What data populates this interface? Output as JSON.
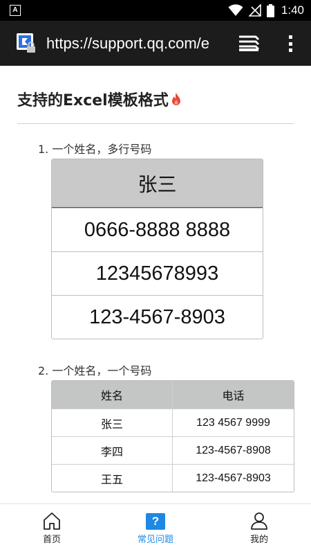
{
  "status_bar": {
    "app_badge": "A",
    "time": "1:40"
  },
  "browser": {
    "url": "https://support.qq.com/e"
  },
  "page": {
    "title": "支持的Excel模板格式",
    "sections": [
      {
        "label": "1. 一个姓名，多行号码",
        "table": {
          "header": "张三",
          "rows": [
            "0666-8888 8888",
            "12345678993",
            "123-4567-8903"
          ]
        }
      },
      {
        "label": "2. 一个姓名，一个号码",
        "table": {
          "headers": [
            "姓名",
            "电话"
          ],
          "rows": [
            [
              "张三",
              "123 4567 9999"
            ],
            [
              "李四",
              "123-4567-8908"
            ],
            [
              "王五",
              "123-4567-8903"
            ]
          ]
        }
      }
    ]
  },
  "bottom_nav": {
    "items": [
      {
        "label": "首页",
        "icon": "home-icon",
        "active": false
      },
      {
        "label": "常见问题",
        "icon": "help-icon",
        "active": true
      },
      {
        "label": "我的",
        "icon": "user-icon",
        "active": false
      }
    ]
  },
  "colors": {
    "accent": "#1e88e5",
    "fire": "#e8493a",
    "toolbar": "#1c1c1c"
  }
}
